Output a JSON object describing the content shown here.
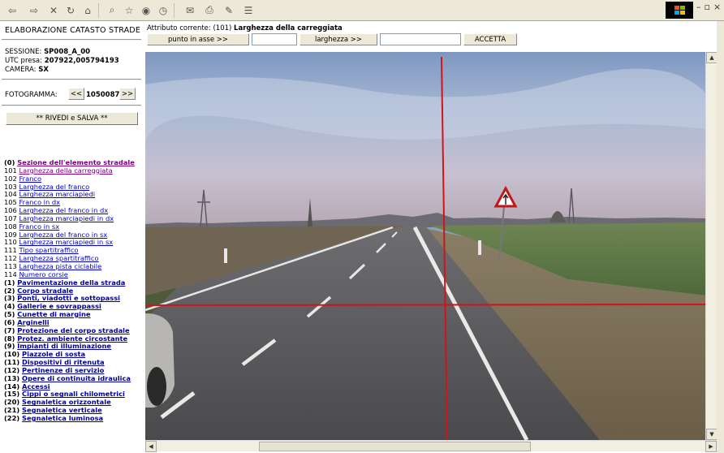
{
  "toolbar": {
    "buttons": [
      "back-icon",
      "forward-icon",
      "stop-icon",
      "refresh-icon",
      "home-icon",
      "search-icon",
      "favorites-icon",
      "media-icon",
      "history-icon",
      "mail-icon",
      "print-icon",
      "edit-icon",
      "discuss-icon"
    ],
    "glyphs": {
      "back": "⇦",
      "forward": "⇨",
      "stop": "✕",
      "refresh": "↻",
      "home": "⌂",
      "search": "⌕",
      "favorites": "☆",
      "media": "◉",
      "history": "◷",
      "mail": "✉",
      "print": "⎙",
      "edit": "✎",
      "discuss": "☰"
    }
  },
  "window": {
    "minimize": "–",
    "maximize": "▫",
    "close": "×"
  },
  "left": {
    "title": "ELABORAZIONE CATASTO STRADE",
    "session_label": "SESSIONE:",
    "session_value": "SP008_A_00",
    "utc_label": "UTC presa:",
    "utc_value": "207922,005794193",
    "camera_label": "CAMERA:",
    "camera_value": "SX",
    "frame_label": "FOTOGRAMMA:",
    "frame_prev": "<<",
    "frame_value": "1050087",
    "frame_next": ">>",
    "rivedi_label": "** RIVEDI e SALVA **"
  },
  "attributes": [
    {
      "code": "(0)",
      "label": "Sezione dell'elemento stradale",
      "group": true,
      "active": true
    },
    {
      "code": "101",
      "label": "Larghezza della carreggiata",
      "visited": true
    },
    {
      "code": "102",
      "label": "Franco"
    },
    {
      "code": "103",
      "label": "Larghezza del franco"
    },
    {
      "code": "104",
      "label": "Larghezza marciapiedi"
    },
    {
      "code": "105",
      "label": "Franco in dx"
    },
    {
      "code": "106",
      "label": "Larghezza del franco in dx"
    },
    {
      "code": "107",
      "label": "Larghezza marciapiedi in dx"
    },
    {
      "code": "108",
      "label": "Franco in sx"
    },
    {
      "code": "109",
      "label": "Larghezza del franco in sx"
    },
    {
      "code": "110",
      "label": "Larghezza marciapiedi in sx"
    },
    {
      "code": "111",
      "label": "Tipo spartitraffico"
    },
    {
      "code": "112",
      "label": "Larghezza spartitraffico"
    },
    {
      "code": "113",
      "label": "Larghezza pista ciclabile"
    },
    {
      "code": "114",
      "label": "Numero corsie"
    },
    {
      "code": "(1)",
      "label": "Pavimentazione della strada",
      "group": true
    },
    {
      "code": "(2)",
      "label": "Corpo stradale",
      "group": true
    },
    {
      "code": "(3)",
      "label": "Ponti, viadotti e sottopassi",
      "group": true
    },
    {
      "code": "(4)",
      "label": "Gallerie e sovrappassi",
      "group": true
    },
    {
      "code": "(5)",
      "label": "Cunette di margine",
      "group": true
    },
    {
      "code": "(6)",
      "label": "Arginelli",
      "group": true
    },
    {
      "code": "(7)",
      "label": "Protezione del corpo stradale",
      "group": true
    },
    {
      "code": "(8)",
      "label": "Protez. ambiente circostante",
      "group": true
    },
    {
      "code": "(9)",
      "label": "Impianti di illuminazione",
      "group": true
    },
    {
      "code": "(10)",
      "label": "Piazzole di sosta",
      "group": true
    },
    {
      "code": "(11)",
      "label": "Dispositivi di ritenuta",
      "group": true
    },
    {
      "code": "(12)",
      "label": "Pertinenze di servizio",
      "group": true
    },
    {
      "code": "(13)",
      "label": "Opere di continuita idraulica",
      "group": true
    },
    {
      "code": "(14)",
      "label": "Accessi",
      "group": true
    },
    {
      "code": "(15)",
      "label": "Cippi o segnali chilometrici",
      "group": true
    },
    {
      "code": "(20)",
      "label": "Segnaletica orizzontale",
      "group": true
    },
    {
      "code": "(21)",
      "label": "Segnaletica verticale",
      "group": true
    },
    {
      "code": "(22)",
      "label": "Segnaletica luminosa",
      "group": true
    }
  ],
  "topbar": {
    "current_label": "Attributo corrente:",
    "current_code": "(101)",
    "current_name": "Larghezza della carreggiata",
    "punto_label": "punto in asse >>",
    "punto_value": "",
    "larghezza_label": "larghezza >>",
    "larghezza_value": "",
    "accetta_label": "ACCETTA"
  },
  "colors": {
    "crosshair": "#d0141c",
    "link": "#0000cc",
    "visited": "#800080"
  }
}
